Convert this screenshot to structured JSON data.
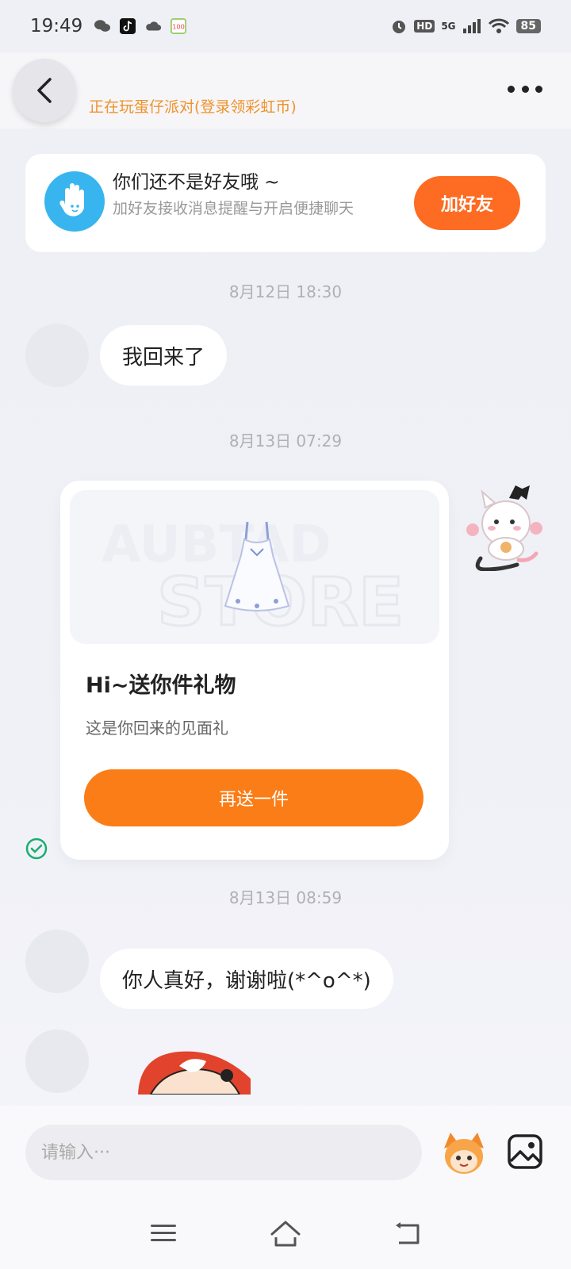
{
  "status_bar": {
    "time": "19:49",
    "network": "5G",
    "battery": "85",
    "hd_label": "HD"
  },
  "header": {
    "status_text": "正在玩蛋仔派对(登录领彩虹币)"
  },
  "friend_banner": {
    "title": "你们还不是好友哦 ~",
    "description": "加好友接收消息提醒与开启便捷聊天",
    "button_label": "加好友"
  },
  "messages": [
    {
      "type": "timestamp",
      "text": "8月12日 18:30"
    },
    {
      "type": "text",
      "from": "other",
      "text": "我回来了"
    },
    {
      "type": "timestamp",
      "text": "8月13日 07:29"
    },
    {
      "type": "gift",
      "from": "me",
      "title": "Hi~送你件礼物",
      "subtitle": "这是你回来的见面礼",
      "button_label": "再送一件",
      "watermark_top": "AUBTAD",
      "watermark_bottom": "STORE",
      "status": "read"
    },
    {
      "type": "timestamp",
      "text": "8月13日 08:59"
    },
    {
      "type": "text",
      "from": "other",
      "text": "你人真好，谢谢啦(*^o^*)"
    },
    {
      "type": "sticker",
      "from": "other"
    }
  ],
  "input_bar": {
    "placeholder": "请输入···",
    "emoji_icon": "eggy-emoji-icon",
    "image_icon": "image-icon"
  },
  "nav_bar": {
    "icons": [
      "menu-icon",
      "home-icon",
      "back-nav-icon"
    ]
  },
  "colors": {
    "accent_orange": "#fb7d17",
    "status_orange": "#f0922b",
    "hand_blue": "#38b5ef",
    "check_green": "#1aad6f"
  }
}
